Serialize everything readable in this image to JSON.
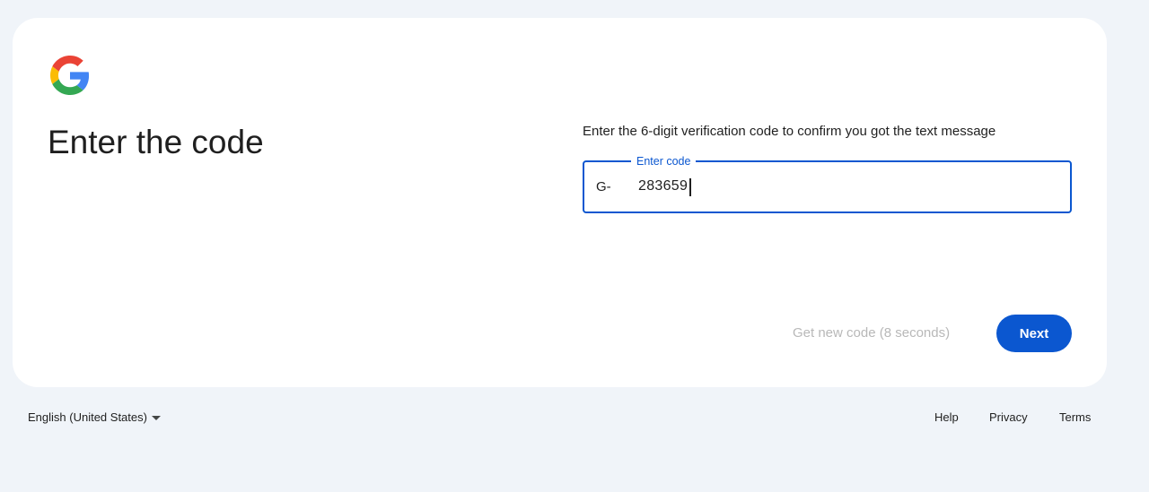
{
  "card": {
    "title": "Enter the code",
    "instructions": "Enter the 6-digit verification code to confirm you got the text message",
    "code_field": {
      "label": "Enter code",
      "prefix": "G-",
      "value": "283659"
    },
    "resend_label": "Get new code (8 seconds)",
    "next_label": "Next"
  },
  "footer": {
    "language": "English (United States)",
    "links": [
      "Help",
      "Privacy",
      "Terms"
    ]
  },
  "colors": {
    "accent": "#0b57d0",
    "background": "#f0f4f9",
    "disabled_text": "#b8b8b8"
  },
  "icons": {
    "logo": "google-g-logo",
    "language_dropdown": "caret-down-icon"
  }
}
